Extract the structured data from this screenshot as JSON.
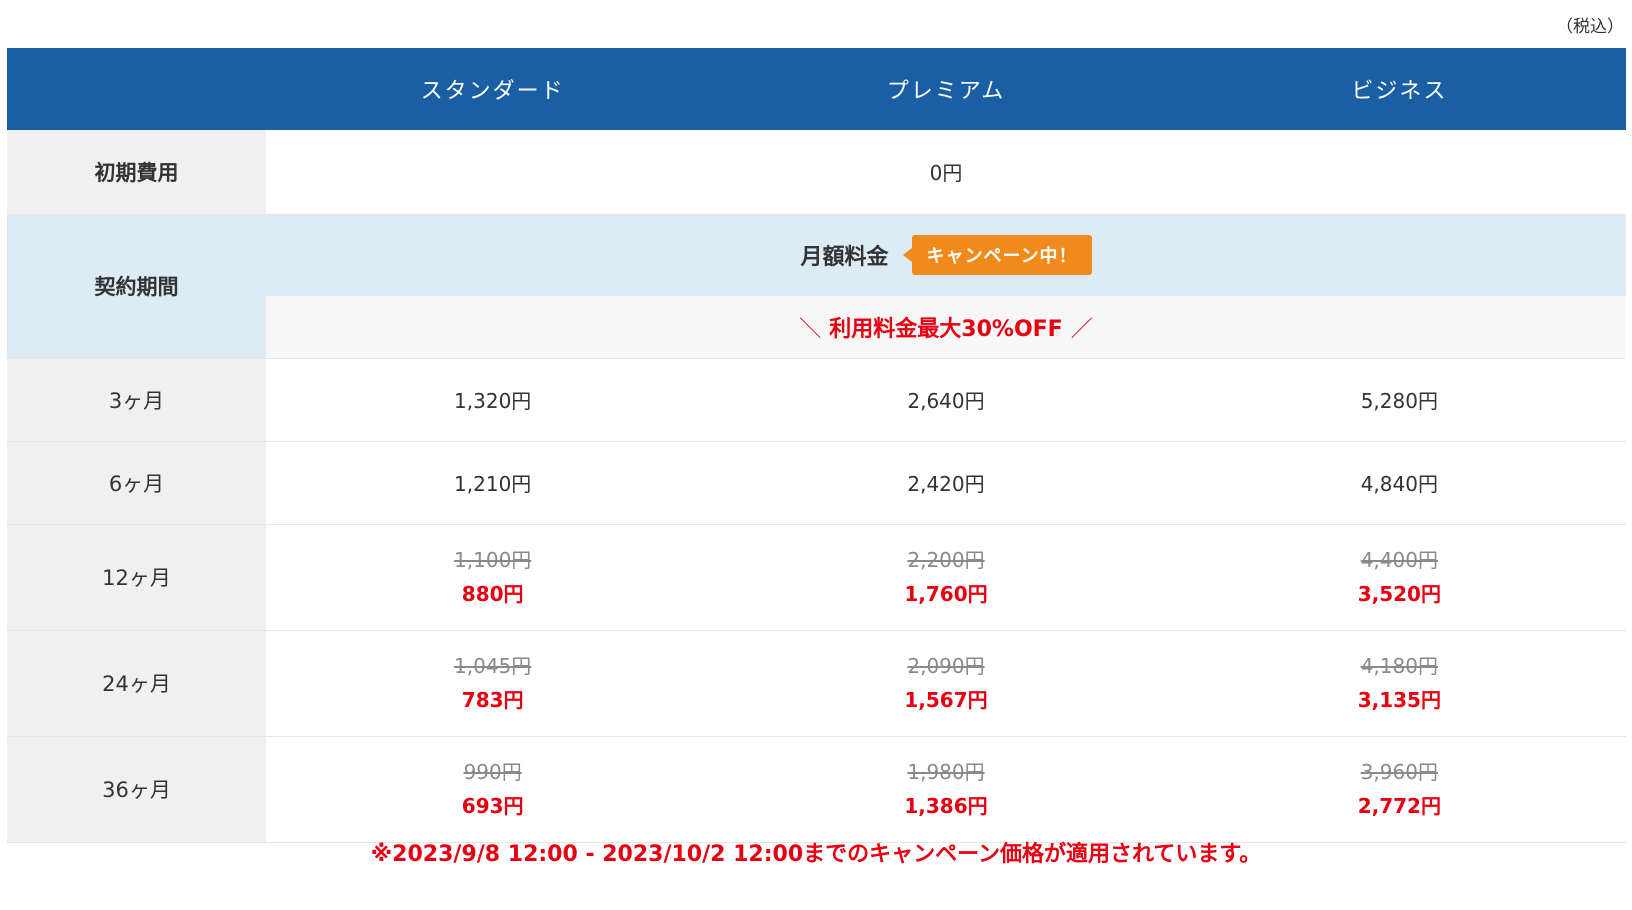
{
  "tax_note": "（税込）",
  "header": {
    "plans": [
      "スタンダード",
      "プレミアム",
      "ビジネス"
    ]
  },
  "initial_fee": {
    "label": "初期費用",
    "value": "0円"
  },
  "contract": {
    "label": "契約期間",
    "monthly_label": "月額料金",
    "campaign_badge": "キャンペーン中！",
    "offer_left": "＼",
    "offer_text": "利用料金最大30%OFF",
    "offer_right": "／"
  },
  "rows": [
    {
      "period": "3ヶ月",
      "prices": [
        "1,320円",
        "2,640円",
        "5,280円"
      ]
    },
    {
      "period": "6ヶ月",
      "prices": [
        "1,210円",
        "2,420円",
        "4,840円"
      ]
    },
    {
      "period": "12ヶ月",
      "original": [
        "1,100円",
        "2,200円",
        "4,400円"
      ],
      "discounted": [
        "880円",
        "1,760円",
        "3,520円"
      ]
    },
    {
      "period": "24ヶ月",
      "original": [
        "1,045円",
        "2,090円",
        "4,180円"
      ],
      "discounted": [
        "783円",
        "1,567円",
        "3,135円"
      ]
    },
    {
      "period": "36ヶ月",
      "original": [
        "990円",
        "1,980円",
        "3,960円"
      ],
      "discounted": [
        "693円",
        "1,386円",
        "2,772円"
      ]
    }
  ],
  "footnote": "※2023/9/8 12:00 - 2023/10/2 12:00までのキャンペーン価格が適用されています。",
  "colors": {
    "header_bg": "#1a5fa3",
    "campaign_badge": "#f08a1c",
    "discount_red": "#e60012",
    "label_bg": "#f0f0f0",
    "highlight_blue": "#ddebf5"
  }
}
